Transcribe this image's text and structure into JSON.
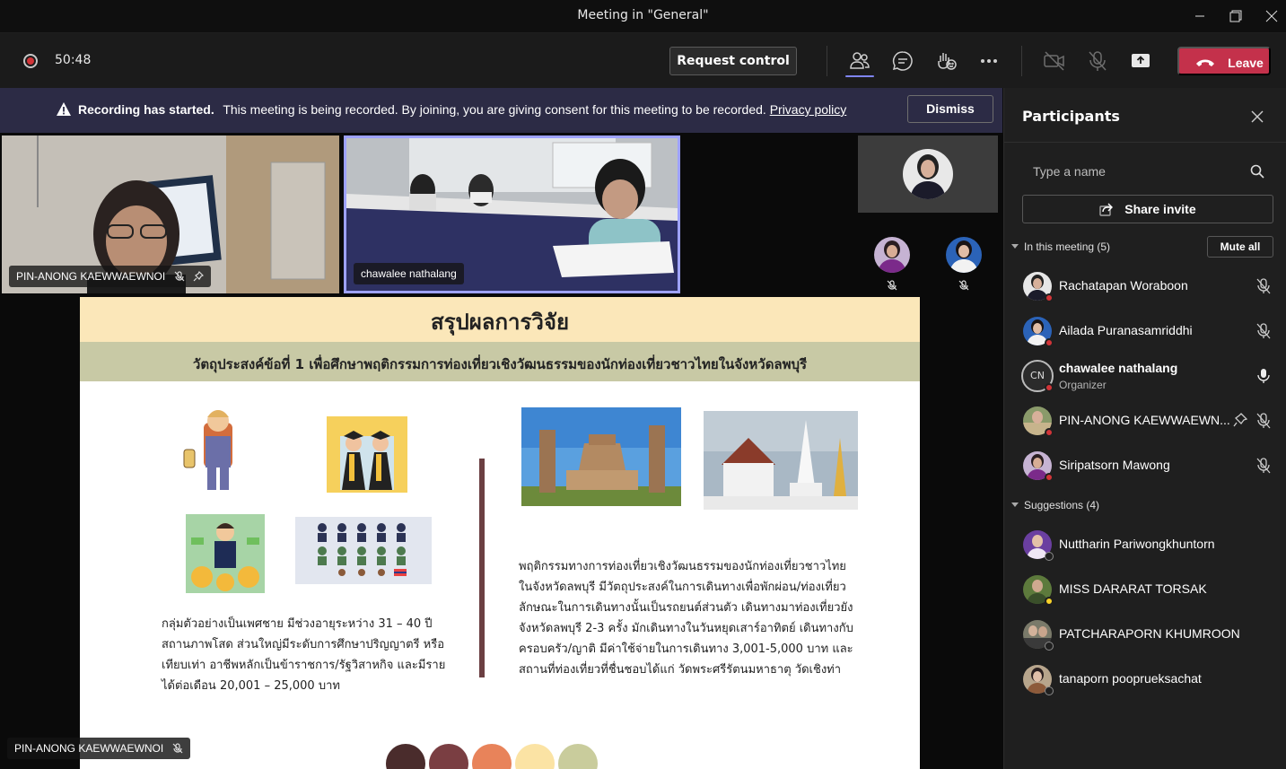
{
  "window": {
    "title": "Meeting in \"General\""
  },
  "toolbar": {
    "timer": "50:48",
    "request_control_label": "Request control",
    "leave_label": "Leave",
    "icons": [
      "participants-icon",
      "chat-icon",
      "reactions-icon",
      "more-icon",
      "camera-off-icon",
      "mic-off-icon",
      "share-screen-icon"
    ]
  },
  "banner": {
    "bold_text": "Recording has started.",
    "message": "This meeting is being recorded. By joining, you are giving consent for this meeting to be recorded.",
    "link_text": "Privacy policy",
    "dismiss_label": "Dismiss"
  },
  "video_tiles": [
    {
      "name": "PIN-ANONG KAEWWAEWNOI",
      "muted": true,
      "pinned": true
    },
    {
      "name": "chawalee nathalang",
      "active_speaker": true
    }
  ],
  "slide": {
    "title": "สรุปผลการวิจัย",
    "subtitle": "วัตถุประสงค์ข้อที่ 1 เพื่อศึกษาพฤติกรรมการท่องเที่ยวเชิงวัฒนธรรมของนักท่องเที่ยวชาวไทยในจังหวัดลพบุรี",
    "left_text": "กลุ่มตัวอย่างเป็นเพศชาย มีช่วงอายุระหว่าง 31 – 40 ปี สถานภาพโสด ส่วนใหญ่มีระดับการศึกษาปริญญาตรี หรือเทียบเท่า อาชีพหลักเป็นข้าราชการ/รัฐวิสาหกิจ และมีรายได้ต่อเดือน 20,001 – 25,000 บาท",
    "right_text": "พฤติกรรมทางการท่องเที่ยวเชิงวัฒนธรรมของนักท่องเที่ยวชาวไทย ในจังหวัดลพบุรี มีวัตถุประสงค์ในการเดินทางเพื่อพักผ่อน/ท่องเที่ยว ลักษณะในการเดินทางนั้นเป็นรถยนต์ส่วนตัว เดินทางมาท่องเที่ยวยังจังหวัดลพบุรี 2-3 ครั้ง มักเดินทางในวันหยุดเสาร์อาทิตย์ เดินทางกับครอบครัว/ญาติ มีค่าใช้จ่ายในการเดินทาง 3,001-5,000 บาท และสถานที่ท่องเที่ยวที่ชื่นชอบได้แก่ วัดพระศรีรัตนมหาธาตุ วัดเชิงท่า",
    "palette": [
      "#4a2c2c",
      "#7a3e42",
      "#e8835a",
      "#fbe3a4",
      "#c9cc9c"
    ]
  },
  "presenter_tag": {
    "name": "PIN-ANONG KAEWWAEWNOI"
  },
  "participants_panel": {
    "title": "Participants",
    "search_placeholder": "Type a name",
    "share_invite_label": "Share invite",
    "in_meeting_header": "In this meeting (5)",
    "mute_all_label": "Mute all",
    "in_meeting": [
      {
        "name": "Rachatapan Woraboon",
        "mic": "off"
      },
      {
        "name": "Ailada Puranasamriddhi",
        "mic": "off"
      },
      {
        "name": "chawalee nathalang",
        "role": "Organizer",
        "initials": "CN",
        "mic": "on"
      },
      {
        "name": "PIN-ANONG KAEWWAEWN...",
        "mic": "off",
        "pinned": true
      },
      {
        "name": "Siripatsorn Mawong",
        "mic": "off"
      }
    ],
    "suggestions_header": "Suggestions (4)",
    "suggestions": [
      {
        "name": "Nuttharin Pariwongkhuntorn"
      },
      {
        "name": "MISS DARARAT TORSAK"
      },
      {
        "name": "PATCHARAPORN KHUMROON"
      },
      {
        "name": "tanaporn pooprueksachat"
      }
    ]
  },
  "colors": {
    "accent": "#7f85f5",
    "leave": "#c4314b",
    "banner": "#2c2b45",
    "recording": "#d13438"
  }
}
